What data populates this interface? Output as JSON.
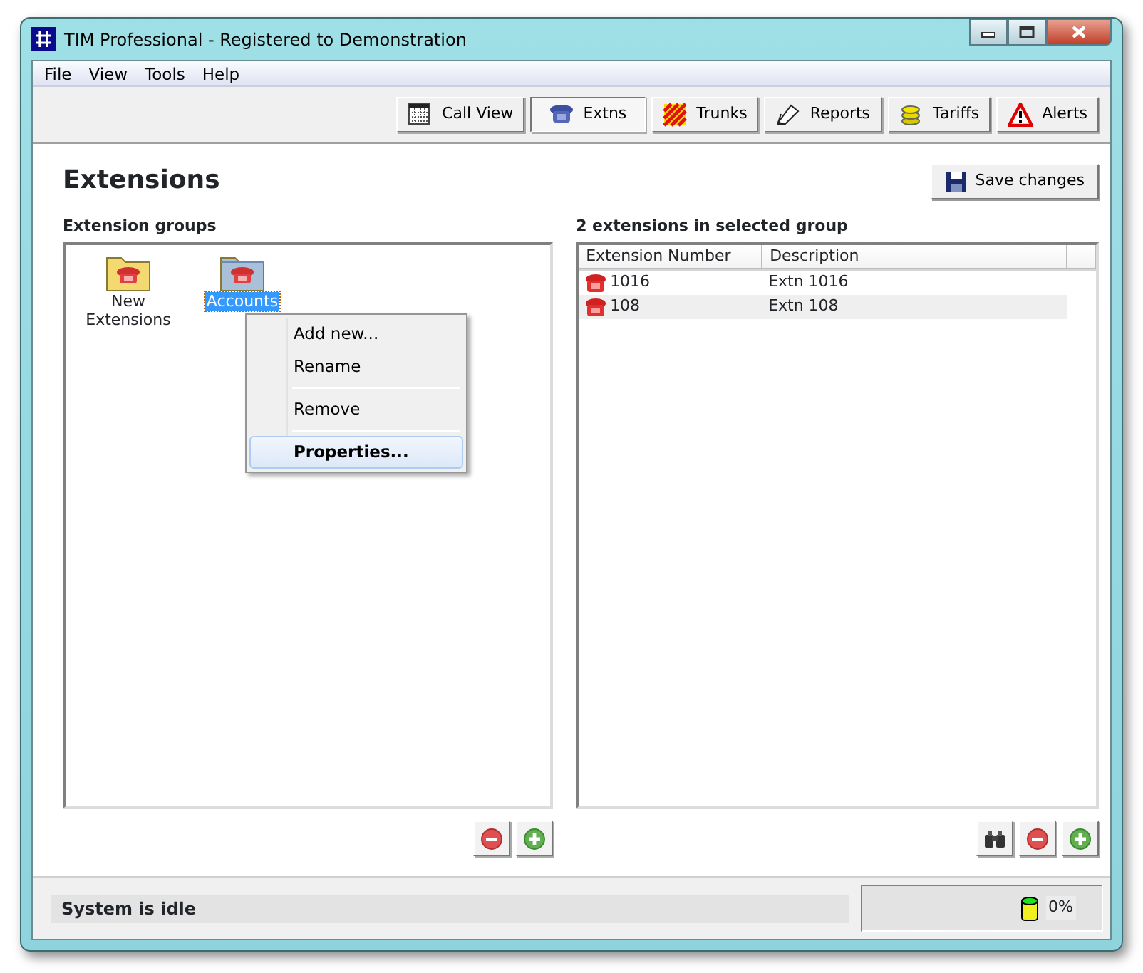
{
  "window": {
    "title": "TIM Professional - Registered to Demonstration"
  },
  "menu": [
    "File",
    "View",
    "Tools",
    "Help"
  ],
  "toolbar": [
    {
      "label": "Call View",
      "kind": "grid",
      "selected": false
    },
    {
      "label": "Extns",
      "kind": "phone",
      "selected": true
    },
    {
      "label": "Trunks",
      "kind": "stripes",
      "selected": false
    },
    {
      "label": "Reports",
      "kind": "pen",
      "selected": false
    },
    {
      "label": "Tariffs",
      "kind": "coins",
      "selected": false
    },
    {
      "label": "Alerts",
      "kind": "warning",
      "selected": false
    }
  ],
  "page_title": "Extensions",
  "save_button": "Save changes",
  "groups_panel": {
    "heading": "Extension groups",
    "items": [
      {
        "label": "New Extensions",
        "selected": false
      },
      {
        "label": "Accounts",
        "selected": true
      }
    ]
  },
  "context_menu": {
    "items": [
      {
        "label": "Add new...",
        "separator_before": false,
        "default": false,
        "highlighted": false
      },
      {
        "label": "Rename",
        "separator_before": false,
        "default": false,
        "highlighted": false
      },
      {
        "label": "Remove",
        "separator_before": true,
        "default": false,
        "highlighted": false
      },
      {
        "label": "Properties...",
        "separator_before": true,
        "default": true,
        "highlighted": true
      }
    ]
  },
  "extensions_panel": {
    "heading": "2 extensions in selected group",
    "columns": [
      "Extension Number",
      "Description"
    ],
    "rows": [
      {
        "number": "1016",
        "description": "Extn 1016",
        "selected": false
      },
      {
        "number": "108",
        "description": "Extn 108",
        "selected": true
      }
    ]
  },
  "status_bar": {
    "message": "System is idle",
    "usage": "0%"
  }
}
